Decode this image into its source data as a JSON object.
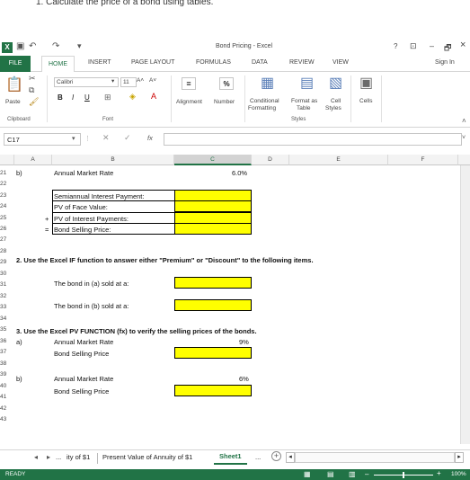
{
  "caption": "1. Calculate the price of a bond using tables.",
  "window": {
    "title": "Bond Pricing - Excel",
    "help": "?",
    "minimize": "–",
    "restore": "🗗",
    "close": "×"
  },
  "ribbon_tabs": {
    "file": "FILE",
    "home": "HOME",
    "insert": "INSERT",
    "page_layout": "PAGE LAYOUT",
    "formulas": "FORMULAS",
    "data": "DATA",
    "review": "REVIEW",
    "view": "VIEW",
    "sign_in": "Sign In"
  },
  "ribbon": {
    "paste": "Paste",
    "clipboard": "Clipboard",
    "font_name": "Calibri",
    "font_size": "11",
    "font_group": "Font",
    "bold": "B",
    "italic": "I",
    "underline": "U",
    "alignment": "Alignment",
    "number": "Number",
    "number_icon": "%",
    "conditional": "Conditional",
    "formatting": "Formatting",
    "format_as": "Format as",
    "table": "Table",
    "cell": "Cell",
    "styles_btn": "Styles",
    "cells": "Cells",
    "styles_group": "Styles"
  },
  "formula_bar": {
    "name_box": "C17",
    "fx": "fx",
    "formula": ""
  },
  "columns": [
    "A",
    "B",
    "C",
    "D",
    "E",
    "F"
  ],
  "rows": [
    "21",
    "22",
    "23",
    "24",
    "25",
    "26",
    "27",
    "28",
    "29",
    "30",
    "31",
    "32",
    "33",
    "34",
    "35",
    "36",
    "37",
    "38",
    "39",
    "40",
    "41",
    "42",
    "43"
  ],
  "cells": {
    "a21": "b)",
    "b21": "Annual Market Rate",
    "c21": "6.0%",
    "b23": "Semiannual Interest Payment:",
    "b24": "PV of Face Value:",
    "a25": "+",
    "b25": "PV of Interest Payments:",
    "a26": "=",
    "b26": "Bond Selling Price:",
    "a28": "2. Use the Excel IF function to answer either \"Premium\" or \"Discount\" to the following items.",
    "b30": "The bond in (a) sold at a:",
    "b32": "The bond in (b) sold at a:",
    "a34": "3. Use the Excel PV FUNCTION (fx) to verify the selling prices of the bonds.",
    "a35": "a)",
    "b35": "Annual Market Rate",
    "c35": "9%",
    "b36": "Bond Selling Price",
    "a38": "b)",
    "b38": "Annual Market Rate",
    "c38": "6%",
    "b39": "Bond Selling Price"
  },
  "sheet_tabs": {
    "ellipsis_left": "...",
    "tab1": "ity of $1",
    "tab2": "Present Value of Annuity of $1",
    "tab3": "Sheet1",
    "ellipsis_right": "...",
    "add": "+"
  },
  "status": {
    "ready": "READY",
    "zoom": "100%"
  },
  "colors": {
    "excel_green": "#217346",
    "highlight": "#ffff00"
  }
}
